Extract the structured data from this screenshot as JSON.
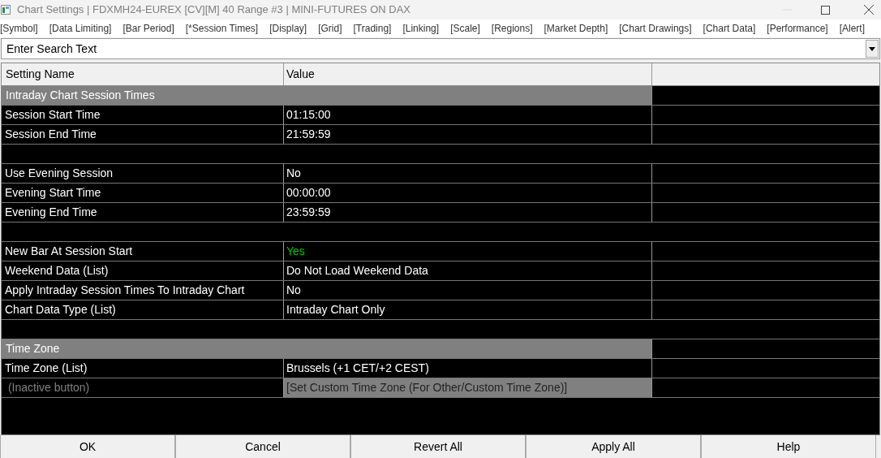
{
  "window": {
    "title": "Chart Settings | FDXMH24-EUREX [CV][M]  40 Range #3 | MINI-FUTURES ON DAX"
  },
  "tabs": [
    "[Symbol]",
    "[Data Limiting]",
    "[Bar Period]",
    "[*Session Times]",
    "[Display]",
    "[Grid]",
    "[Trading]",
    "[Linking]",
    "[Scale]",
    "[Regions]",
    "[Market Depth]",
    "[Chart Drawings]",
    "[Chart Data]",
    "[Performance]",
    "[Alert]"
  ],
  "search": {
    "value": "Enter Search Text"
  },
  "table": {
    "columns": [
      "Setting Name",
      "Value"
    ],
    "rows": [
      {
        "kind": "section",
        "name": "Intraday Chart Session Times"
      },
      {
        "kind": "setting",
        "name": "Session Start Time",
        "value": "01:15:00"
      },
      {
        "kind": "setting",
        "name": "Session End Time",
        "value": "21:59:59"
      },
      {
        "kind": "blank"
      },
      {
        "kind": "setting",
        "name": "Use Evening Session",
        "value": "No"
      },
      {
        "kind": "setting",
        "name": "Evening Start Time",
        "value": "00:00:00"
      },
      {
        "kind": "setting",
        "name": "Evening End Time",
        "value": "23:59:59"
      },
      {
        "kind": "blank"
      },
      {
        "kind": "setting",
        "name": "New Bar At Session Start",
        "value": "Yes",
        "color": "#00c800"
      },
      {
        "kind": "setting",
        "name": "Weekend Data (List)",
        "value": "Do Not Load Weekend Data"
      },
      {
        "kind": "setting",
        "name": "Apply Intraday Session Times To Intraday Chart",
        "value": "No"
      },
      {
        "kind": "setting",
        "name": "Chart Data Type (List)",
        "value": "Intraday Chart Only"
      },
      {
        "kind": "blank"
      },
      {
        "kind": "section",
        "name": "Time Zone"
      },
      {
        "kind": "setting",
        "name": "Time Zone (List)",
        "value": "Brussels (+1 CET/+2 CEST)"
      },
      {
        "kind": "button",
        "name": " (Inactive button)",
        "value": "[Set Custom Time Zone (For Other/Custom Time Zone)]"
      }
    ]
  },
  "buttons": [
    "OK",
    "Cancel",
    "Revert All",
    "Apply All",
    "Help"
  ]
}
